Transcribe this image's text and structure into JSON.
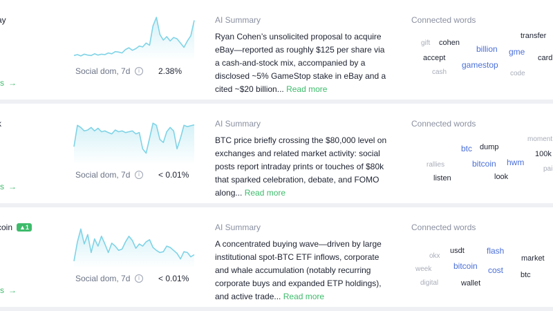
{
  "rows": [
    {
      "asset": "ay",
      "details": "ails",
      "metric_label": "Social dom, 7d",
      "metric_value": "2.38%",
      "summary_heading": "AI Summary",
      "summary": "Ryan Cohen’s unsolicited proposal to acquire eBay—reported as roughly $125 per share via a cash-and-stock mix, accompanied by a disclosed ~5% GameStop stake in eBay and a cited ~$20 billion...",
      "read_more": "Read more",
      "words_heading": "Connected words",
      "words": [
        {
          "text": "gift",
          "style": "grey"
        },
        {
          "text": "cohen",
          "style": "dark"
        },
        {
          "text": "billion",
          "style": "blue"
        },
        {
          "text": "transfer",
          "style": "dark"
        },
        {
          "text": "gme",
          "style": "blue"
        },
        {
          "text": "accept",
          "style": "dark"
        },
        {
          "text": "card",
          "style": "dark"
        },
        {
          "text": "gamestop",
          "style": "blue"
        },
        {
          "text": "cash",
          "style": "grey"
        },
        {
          "text": "code",
          "style": "grey"
        }
      ],
      "sparkline": [
        0.06,
        0.08,
        0.05,
        0.09,
        0.07,
        0.06,
        0.1,
        0.07,
        0.09,
        0.08,
        0.12,
        0.1,
        0.15,
        0.14,
        0.12,
        0.2,
        0.24,
        0.18,
        0.22,
        0.28,
        0.26,
        0.35,
        0.3,
        0.75,
        0.95,
        0.55,
        0.42,
        0.5,
        0.4,
        0.48,
        0.45,
        0.35,
        0.25,
        0.4,
        0.52,
        0.88
      ]
    },
    {
      "asset": "k",
      "details": "ails",
      "metric_label": "Social dom, 7d",
      "metric_value": "< 0.01%",
      "summary_heading": "AI Summary",
      "summary": "BTC price briefly crossing the $80,000 level on exchanges and related market activity: social posts report intraday prints or touches of $80k that sparked celebration, debate, and FOMO along...",
      "read_more": "Read more",
      "words_heading": "Connected words",
      "words": [
        {
          "text": "moment",
          "style": "grey"
        },
        {
          "text": "btc",
          "style": "blue"
        },
        {
          "text": "dump",
          "style": "dark"
        },
        {
          "text": "100k",
          "style": "dark"
        },
        {
          "text": "bitcoin",
          "style": "blue"
        },
        {
          "text": "hwm",
          "style": "blue"
        },
        {
          "text": "rallies",
          "style": "grey"
        },
        {
          "text": "pai",
          "style": "grey"
        },
        {
          "text": "listen",
          "style": "dark"
        },
        {
          "text": "look",
          "style": "dark"
        }
      ],
      "sparkline": [
        0.35,
        0.85,
        0.8,
        0.72,
        0.74,
        0.8,
        0.72,
        0.78,
        0.7,
        0.72,
        0.68,
        0.65,
        0.74,
        0.7,
        0.72,
        0.68,
        0.7,
        0.72,
        0.65,
        0.68,
        0.3,
        0.2,
        0.55,
        0.9,
        0.85,
        0.52,
        0.45,
        0.7,
        0.8,
        0.72,
        0.3,
        0.55,
        0.85,
        0.82,
        0.84,
        0.86
      ]
    },
    {
      "asset": "coin",
      "badge": "▲1",
      "details": "ails",
      "metric_label": "Social dom, 7d",
      "metric_value": "< 0.01%",
      "summary_heading": "AI Summary",
      "summary": "A concentrated buying wave—driven by large institutional spot-BTC ETF inflows, corporate and whale accumulation (notably recurring corporate buys and expanded ETP holdings), and active trade...",
      "read_more": "Read more",
      "words_heading": "Connected words",
      "words": [
        {
          "text": "usdt",
          "style": "dark"
        },
        {
          "text": "flash",
          "style": "blue"
        },
        {
          "text": "okx",
          "style": "grey"
        },
        {
          "text": "market",
          "style": "dark"
        },
        {
          "text": "bitcoin",
          "style": "blue"
        },
        {
          "text": "week",
          "style": "grey"
        },
        {
          "text": "cost",
          "style": "blue"
        },
        {
          "text": "btc",
          "style": "dark"
        },
        {
          "text": "digital",
          "style": "grey"
        },
        {
          "text": "wallet",
          "style": "dark"
        }
      ],
      "sparkline": [
        0.1,
        0.55,
        0.85,
        0.5,
        0.72,
        0.3,
        0.62,
        0.45,
        0.68,
        0.5,
        0.3,
        0.52,
        0.45,
        0.35,
        0.38,
        0.55,
        0.68,
        0.58,
        0.4,
        0.5,
        0.45,
        0.55,
        0.6,
        0.42,
        0.35,
        0.3,
        0.32,
        0.45,
        0.42,
        0.35,
        0.28,
        0.15,
        0.32,
        0.3,
        0.2,
        0.25
      ]
    }
  ]
}
